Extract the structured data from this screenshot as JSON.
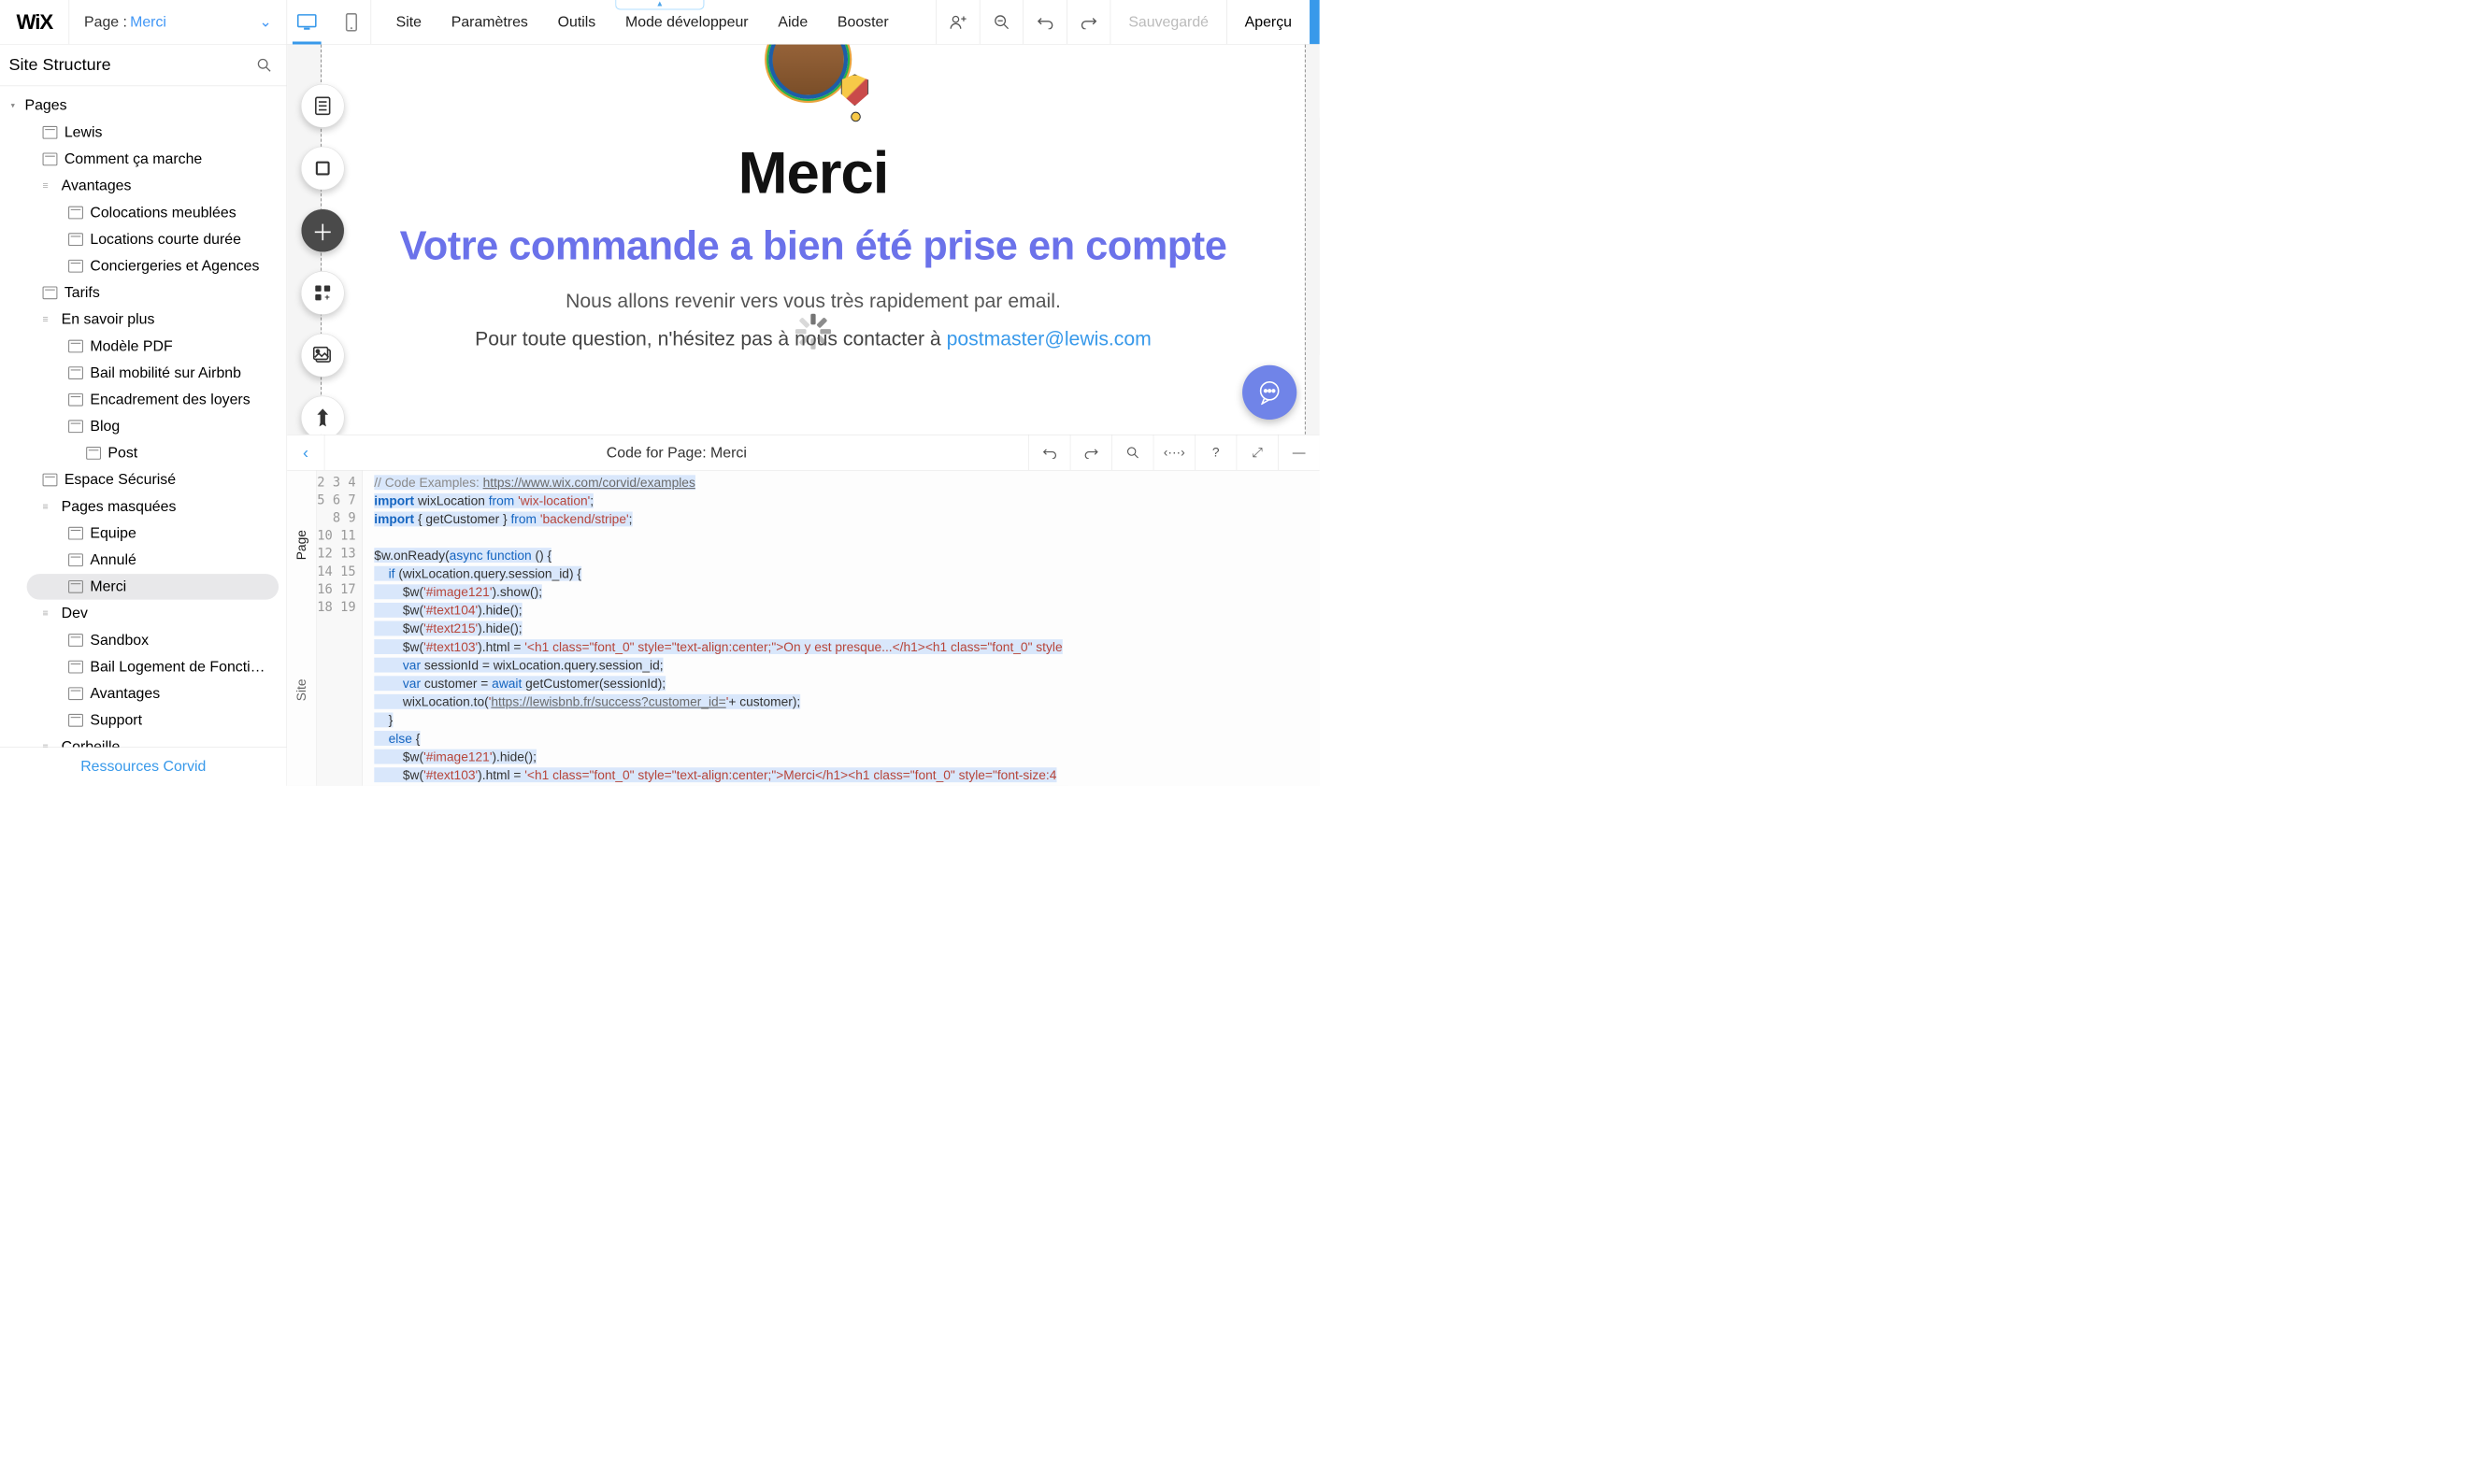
{
  "topbar": {
    "logo": "WiX",
    "page_label": "Page :",
    "page_value": "Merci",
    "menu": [
      "Site",
      "Paramètres",
      "Outils",
      "Mode développeur",
      "Aide",
      "Booster"
    ],
    "save_status": "Sauvegardé",
    "preview": "Aperçu",
    "top_hint": "▲"
  },
  "sidebar": {
    "title": "Site Structure",
    "groups": {
      "pages": "Pages"
    },
    "items": {
      "lewis": "Lewis",
      "comment": "Comment ça marche",
      "avantages": "Avantages",
      "coloc": "Colocations meublées",
      "courte": "Locations courte durée",
      "concierge": "Conciergeries et Agences",
      "tarifs": "Tarifs",
      "savoir": "En savoir plus",
      "modele": "Modèle PDF",
      "bailairbnb": "Bail mobilité sur Airbnb",
      "encadrement": "Encadrement des loyers",
      "blog": "Blog",
      "post": "Post",
      "espace": "Espace Sécurisé",
      "masquees": "Pages masquées",
      "equipe": "Equipe",
      "annule": "Annulé",
      "merci": "Merci",
      "dev": "Dev",
      "sandbox": "Sandbox",
      "baillog": "Bail Logement de Fonction sur …",
      "avantages2": "Avantages",
      "support": "Support",
      "corbeille": "Corbeille"
    },
    "footer": "Ressources Corvid"
  },
  "canvas": {
    "title": "Merci",
    "subtitle": "Votre commande a bien été prise en compte",
    "p1": "Nous allons revenir vers vous très rapidement par email.",
    "p2a": "Pour toute question, n'hésitez pas à nous contacter à ",
    "email": "postmaster@lewis.com"
  },
  "code": {
    "title": "Code for Page: Merci",
    "tab_page": "Page",
    "tab_site": "Site",
    "line_start": 2,
    "line_end": 19,
    "l2a": "// Code Examples: ",
    "l2b": "https://www.wix.com/corvid/examples",
    "l3": "import wixLocation from 'wix-location';",
    "l4": "import { getCustomer } from 'backend/stripe';",
    "l6": "$w.onReady(async function () {",
    "l7": "    if (wixLocation.query.session_id) {",
    "l8": "        $w('#image121').show();",
    "l9": "        $w('#text104').hide();",
    "l10": "        $w('#text215').hide();",
    "l11": "        $w('#text103').html = '<h1 class=\"font_0\" style=\"text-align:center;\">On y est presque...</h1><h1 class=\"font_0\" style",
    "l12": "        var sessionId = wixLocation.query.session_id;",
    "l13": "        var customer = await getCustomer(sessionId);",
    "l14a": "        wixLocation.to('",
    "l14b": "https://lewisbnb.fr/success?customer_id=",
    "l14c": "'+ customer);",
    "l15": "    }",
    "l16": "    else {",
    "l17": "        $w('#image121').hide();",
    "l18": "        $w('#text103').html = '<h1 class=\"font_0\" style=\"text-align:center;\">Merci</h1><h1 class=\"font_0\" style=\"font-size:4",
    "l19": "    }"
  }
}
